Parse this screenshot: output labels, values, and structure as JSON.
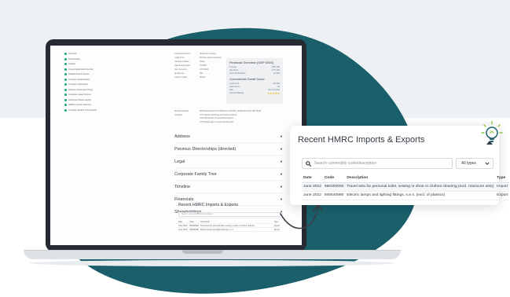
{
  "colors": {
    "blob": "#1a5f6a",
    "band": "#eef1f4",
    "accent": "#1aa37a",
    "bulb": "#8cc63f"
  },
  "sidebar": {
    "items": [
      "Overview",
      "Directorships",
      "Insights",
      "Group Registration Number",
      "Related Search Assets",
      "Company Relationships",
      "Company Resolutions",
      "Statutory Document Filings",
      "Complete Lease Position",
      "Authorised Share Capital",
      "HMRC Imports & Exports",
      "Company Search & Downloads"
    ]
  },
  "details": {
    "rows": [
      [
        "Company Number",
        "Scotland Company"
      ],
      [
        "Legal Form",
        "Private Limited Company"
      ],
      [
        "Company Status",
        "Active"
      ],
      [
        "Date Incorporated",
        "01/1991"
      ],
      [
        "Next Accounts",
        "1/07/2024"
      ],
      [
        "Employees",
        "25k"
      ],
      [
        "Latest Contact",
        "Mobile"
      ]
    ]
  },
  "financial": {
    "title": "Financial Overview (GBP £000)",
    "rows": [
      [
        "Turnover",
        "£367,000"
      ],
      [
        "Net Assets",
        "£774,000"
      ],
      [
        "Gross Profit Margin",
        "22.35%"
      ]
    ],
    "credit_title": "Commercial Credit Score",
    "credit_rows": [
      [
        "Credit Limit",
        "£36,000"
      ],
      [
        "Latest Score",
        "92"
      ],
      [
        "Risk",
        "Very Low Risk"
      ],
      [
        "Payment Ratings",
        "Prompt Payer"
      ]
    ],
    "stars": "★★★★★"
  },
  "purpose": {
    "rows": [
      [
        "Principal Activity",
        "WHOLESALE OF HOUSEHOLD GOODS, SUPPLIES AND TEXTILES"
      ],
      [
        "Activities",
        "4771 Retail of clothing and textile products"
      ],
      [
        "",
        "4730 Wholesale of household products"
      ],
      [
        "",
        "4779 Retail sale of second-hand goods"
      ]
    ]
  },
  "sections": [
    "Address",
    "Previous Directorships (directed)",
    "Legal",
    "Corporate Family Tree",
    "Timeline",
    "Financials",
    "Shareholdings"
  ],
  "mini_recent": {
    "title": "Recent HMRC Imports & Exports",
    "search_placeholder": "Search commodity code/description",
    "rows": [
      [
        "Date",
        "Code",
        "Description",
        "Type"
      ],
      [
        "June 2022",
        "960300000",
        "Travel sets for personal toilet, sewing or shoe or clothes cleaning",
        "Import"
      ],
      [
        "June 2022",
        "940540990",
        "Electric lamps and lighting fittings, n.e.s.",
        "Export"
      ]
    ]
  },
  "card": {
    "title": "Recent HMRC Imports & Exports",
    "search_placeholder": "Search commodity code/description",
    "filter_value": "All types",
    "columns": [
      "Date",
      "Code",
      "Description",
      "Type"
    ],
    "rows": [
      {
        "date": "June 2022",
        "code": "960300000",
        "description": "Travel sets for personal toilet, sewing or shoe or clothes cleaning (excl. manicure sets)",
        "type": "Import"
      },
      {
        "date": "June 2022",
        "code": "940540990",
        "description": "Electric lamps and lighting fittings, n.e.s. (excl. of plastics)",
        "type": "Export"
      }
    ]
  }
}
